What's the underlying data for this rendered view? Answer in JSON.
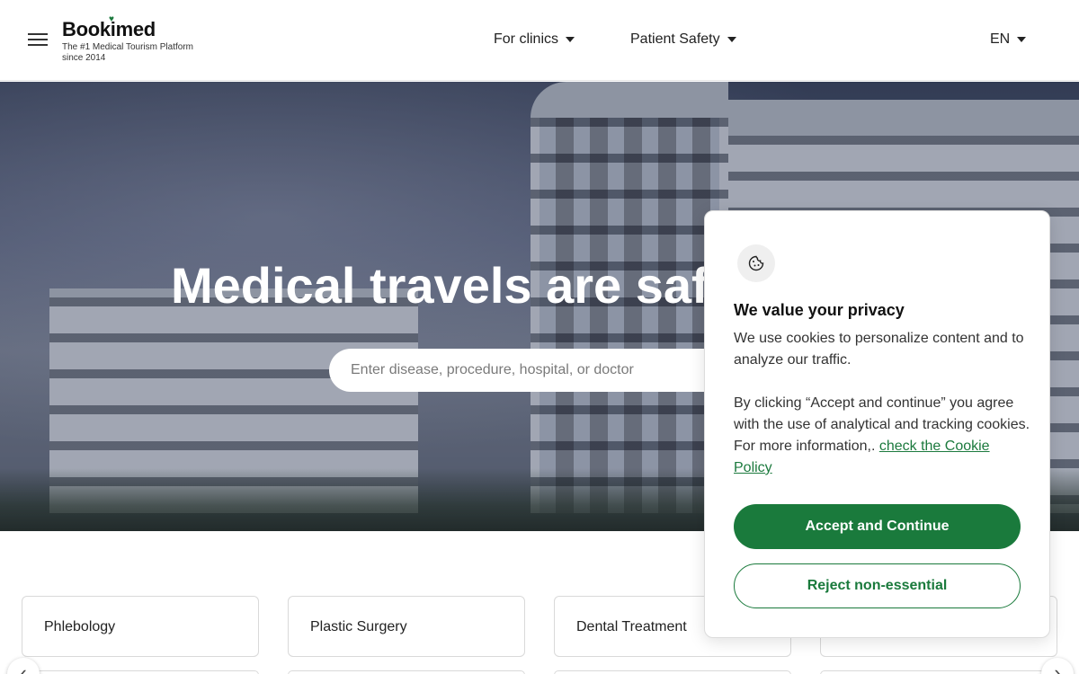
{
  "header": {
    "menu_icon": "hamburger-menu-icon",
    "logo_name": "Bookimed",
    "logo_tagline": "The #1 Medical Tourism Platform since 2014",
    "nav": [
      {
        "label": "For clinics"
      },
      {
        "label": "Patient Safety"
      }
    ],
    "language": "EN"
  },
  "hero": {
    "title": "Medical travels are safe",
    "search_placeholder": "Enter disease, procedure, hospital, or doctor",
    "search_value": ""
  },
  "categories": [
    {
      "label": "Phlebology"
    },
    {
      "label": "Plastic Surgery"
    },
    {
      "label": "Dental Treatment"
    },
    {
      "label": ""
    }
  ],
  "carousel": {
    "prev_icon": "chevron-left-icon",
    "next_icon": "chevron-right-icon"
  },
  "cookie_banner": {
    "icon": "cookie-icon",
    "title": "We value your privacy",
    "text1": "We use cookies to personalize content and to analyze our traffic.",
    "text2_prefix": "By clicking “Accept and continue” you agree with the use of analytical and tracking cookies. For more information,. ",
    "link_text": "check the Cookie Policy",
    "accept_label": "Accept and Continue",
    "reject_label": "Reject non-essential"
  },
  "colors": {
    "brand_green": "#1a7a3c",
    "hero_overlay": "#3b4560"
  }
}
